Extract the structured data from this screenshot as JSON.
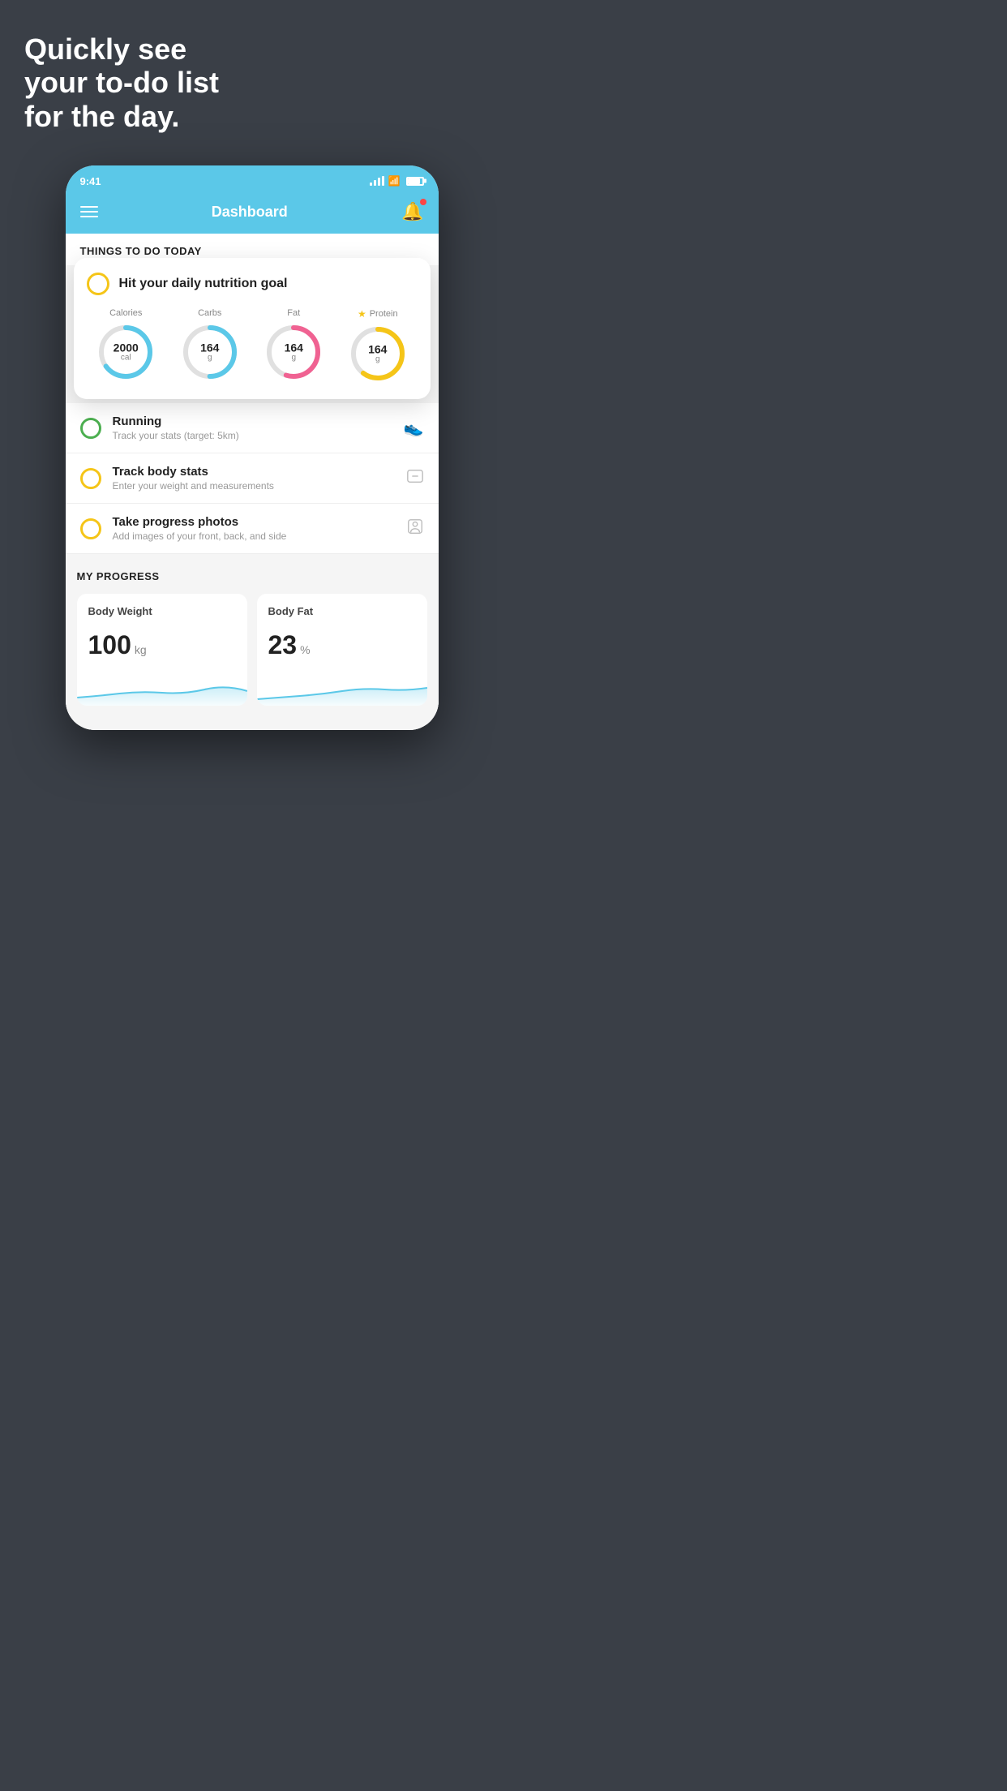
{
  "background": {
    "color": "#3a3f47"
  },
  "headline": {
    "line1": "Quickly see",
    "line2": "your to-do list",
    "line3": "for the day."
  },
  "phone": {
    "status_bar": {
      "time": "9:41",
      "signal": "signal-icon",
      "wifi": "wifi-icon",
      "battery": "battery-icon"
    },
    "nav_bar": {
      "title": "Dashboard",
      "menu_icon": "hamburger-icon",
      "bell_icon": "bell-icon"
    },
    "things_section": {
      "header": "THINGS TO DO TODAY"
    },
    "nutrition_card": {
      "title": "Hit your daily nutrition goal",
      "metrics": [
        {
          "label": "Calories",
          "value": "2000",
          "unit": "cal",
          "color": "#5bc8e8",
          "track_color": "#e0e0e0",
          "pct": 65
        },
        {
          "label": "Carbs",
          "value": "164",
          "unit": "g",
          "color": "#5bc8e8",
          "track_color": "#e0e0e0",
          "pct": 50
        },
        {
          "label": "Fat",
          "value": "164",
          "unit": "g",
          "color": "#f06292",
          "track_color": "#e0e0e0",
          "pct": 55
        },
        {
          "label": "Protein",
          "value": "164",
          "unit": "g",
          "color": "#f5c518",
          "track_color": "#e0e0e0",
          "pct": 60,
          "starred": true
        }
      ]
    },
    "todo_items": [
      {
        "circle_color": "green",
        "title": "Running",
        "subtitle": "Track your stats (target: 5km)",
        "icon": "shoe-icon"
      },
      {
        "circle_color": "yellow",
        "title": "Track body stats",
        "subtitle": "Enter your weight and measurements",
        "icon": "scale-icon"
      },
      {
        "circle_color": "yellow",
        "title": "Take progress photos",
        "subtitle": "Add images of your front, back, and side",
        "icon": "person-icon"
      }
    ],
    "progress_section": {
      "title": "MY PROGRESS",
      "cards": [
        {
          "title": "Body Weight",
          "value": "100",
          "unit": "kg",
          "sparkline_color": "#5bc8e8"
        },
        {
          "title": "Body Fat",
          "value": "23",
          "unit": "%",
          "sparkline_color": "#5bc8e8"
        }
      ]
    }
  }
}
